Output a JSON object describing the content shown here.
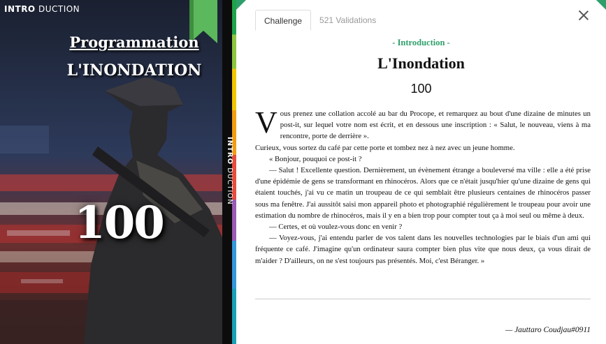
{
  "cover": {
    "brand_bold": "INTRO",
    "brand_light": " DUCTION",
    "title": "Programmation",
    "subtitle": "L'INONDATION",
    "number": "100",
    "spine_bold": "INTRO",
    "spine_light": " DUCTION"
  },
  "tabs": {
    "challenge": "Challenge",
    "validations": "521 Validations"
  },
  "header": {
    "section": "- Introduction -",
    "title": "L'Inondation",
    "number": "100"
  },
  "story": {
    "dropcap": "V",
    "p1": "ous prenez une collation accolé au bar du Procope, et remarquez au bout d'une dizaine de minutes un post-it, sur lequel votre nom est écrit, et en dessous une inscription : « Salut, le nouveau, viens à ma rencontre, porte de derrière ».",
    "p2": "Curieux, vous sortez du café par cette porte et tombez nez à nez avec un jeune homme.",
    "p3": "« Bonjour, pouquoi ce post-it ?",
    "p4": "— Salut ! Excellente question. Dernièrement, un évènement étrange a bouleversé ma ville : elle a été prise d'une épidémie de gens se transformant en rhinocéros. Alors que ce n'était jusqu'hier qu'une dizaine de gens qui étaient touchés, j'ai vu ce matin un troupeau de ce qui semblait être plusieurs centaines de rhinocéros passer sous ma fenêtre. J'ai aussitôt saisi mon appareil photo et photographié régulièrement le troupeau pour avoir une estimation du nombre de rhinocéros, mais il y en a bien trop pour compter tout ça à moi seul ou même à deux.",
    "p5": "— Certes, et où voulez-vous donc en venir ?",
    "p6": "— Voyez-vous, j'ai entendu parler de vos talent dans les nouvelles technologies par le biais d'un ami qui fréquente ce café. J'imagine qu'un ordinateur saura compter bien plus vite que nous deux, ça vous dirait de m'aider ? D'ailleurs, on ne s'est toujours pas présentés. Moi, c'est Béranger. »"
  },
  "footer": {
    "author": "— Jauttaro Coudjau#0911"
  },
  "colors": {
    "accent": "#2e9e6a",
    "ribbon": "#5cb85c"
  }
}
